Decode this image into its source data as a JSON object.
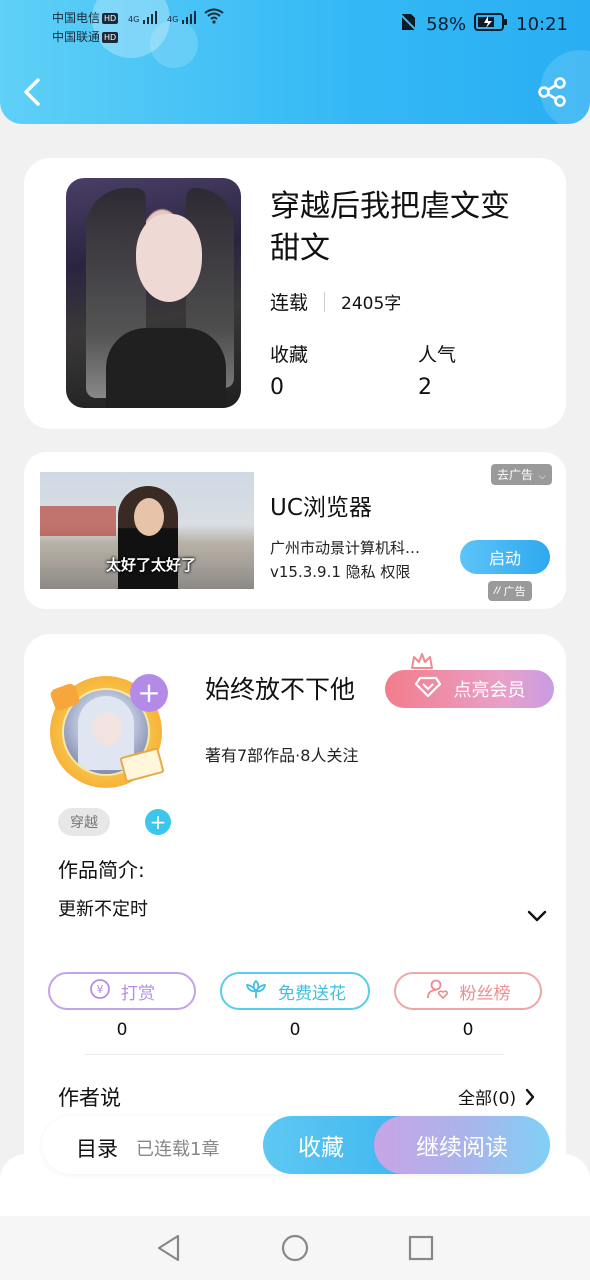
{
  "status_bar": {
    "carrier1": "中国电信",
    "carrier2": "中国联通",
    "hd": "HD",
    "net": "4G",
    "battery": "58%",
    "time": "10:21"
  },
  "book": {
    "title": "穿越后我把虐文变甜文",
    "status": "连载",
    "word_count": "2405字",
    "favorites_label": "收藏",
    "favorites_value": "0",
    "popularity_label": "人气",
    "popularity_value": "2"
  },
  "ad": {
    "tag": "去广告",
    "caption": "太好了太好了",
    "app_name": "UC浏览器",
    "company": "广州市动景计算机科…",
    "version_line": "v15.3.9.1  隐私  权限",
    "start_label": "启动",
    "ad_label": "广告"
  },
  "author": {
    "name": "始终放不下他",
    "vip_label": "点亮会员",
    "meta": "著有7部作品·8人关注",
    "genre_tag": "穿越",
    "intro_heading": "作品简介:",
    "intro_text": "更新不定时"
  },
  "actions": [
    {
      "label": "打赏",
      "count": "0",
      "color": "#b58de6"
    },
    {
      "label": "免费送花",
      "count": "0",
      "color": "#4ccbe9"
    },
    {
      "label": "粉丝榜",
      "count": "0",
      "color": "#ee8d8f"
    }
  ],
  "author_says": {
    "heading": "作者说",
    "all_label": "全部(0)"
  },
  "bottom_bar": {
    "toc": "目录",
    "chapters": "已连载1章",
    "favorite": "收藏",
    "continue": "继续阅读"
  }
}
